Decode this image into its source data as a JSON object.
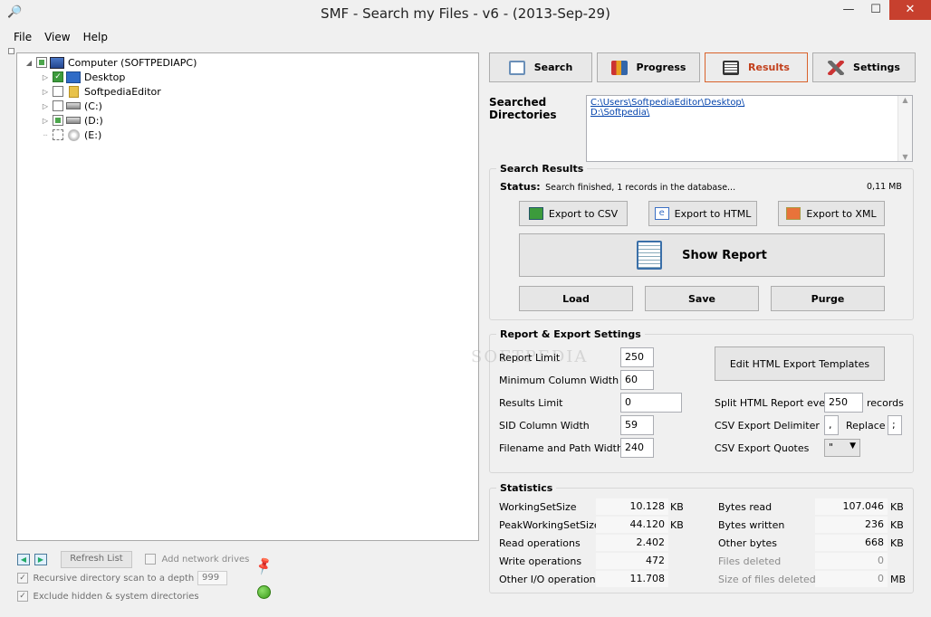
{
  "window": {
    "title": "SMF - Search my Files - v6 - (2013-Sep-29)",
    "minimize": "—",
    "maximize": "☐",
    "close": "✕"
  },
  "menu": [
    "File",
    "View",
    "Help"
  ],
  "tree": {
    "root": "Computer (SOFTPEDIAPC)",
    "items": [
      {
        "label": "Desktop",
        "state": "checked"
      },
      {
        "label": "SoftpediaEditor",
        "state": "empty"
      },
      {
        "label": "(C:)",
        "state": "empty"
      },
      {
        "label": "(D:)",
        "state": "partial"
      },
      {
        "label": "(E:)",
        "state": "empty"
      }
    ]
  },
  "tabs": [
    {
      "label": "Search"
    },
    {
      "label": "Progress"
    },
    {
      "label": "Results"
    },
    {
      "label": "Settings"
    }
  ],
  "searched": {
    "label_line1": "Searched",
    "label_line2": "Directories",
    "dirs": [
      "C:\\Users\\SoftpediaEditor\\Desktop\\",
      "D:\\Softpedia\\"
    ]
  },
  "results": {
    "title": "Search Results",
    "status_label": "Status:",
    "status_text": "Search finished, 1 records in the database...",
    "size": "0,11 MB",
    "export_csv": "Export to CSV",
    "export_html": "Export to HTML",
    "export_xml": "Export to XML",
    "show_report": "Show Report",
    "load": "Load",
    "save": "Save",
    "purge": "Purge"
  },
  "report": {
    "title": "Report & Export Settings",
    "report_limit_label": "Report Limit",
    "report_limit": "250",
    "min_col_label": "Minimum Column Width",
    "min_col": "60",
    "results_limit_label": "Results Limit",
    "results_limit": "0",
    "sid_col_label": "SID Column Width",
    "sid_col": "59",
    "filename_label": "Filename and Path Width",
    "filename": "240",
    "edit_templates": "Edit HTML Export Templates",
    "split_label": "Split HTML Report every",
    "split": "250",
    "split_unit": "records",
    "csv_delim_label": "CSV Export Delimiter",
    "csv_delim": ",",
    "replace_label": "Replace",
    "replace": ";",
    "csv_quotes_label": "CSV Export Quotes",
    "csv_quotes": "\""
  },
  "stats": {
    "title": "Statistics",
    "left": [
      {
        "label": "WorkingSetSize",
        "value": "10.128",
        "unit": "KB"
      },
      {
        "label": "PeakWorkingSetSize",
        "value": "44.120",
        "unit": "KB"
      },
      {
        "label": "Read operations",
        "value": "2.402",
        "unit": ""
      },
      {
        "label": "Write operations",
        "value": "472",
        "unit": ""
      },
      {
        "label": "Other I/O operations",
        "value": "11.708",
        "unit": ""
      }
    ],
    "right": [
      {
        "label": "Bytes read",
        "value": "107.046",
        "unit": "KB"
      },
      {
        "label": "Bytes written",
        "value": "236",
        "unit": "KB"
      },
      {
        "label": "Other bytes",
        "value": "668",
        "unit": "KB"
      },
      {
        "label": "Files deleted",
        "value": "0",
        "unit": ""
      },
      {
        "label": "Size of files deleted",
        "value": "0",
        "unit": "MB"
      }
    ]
  },
  "bottom": {
    "refresh": "Refresh List",
    "add_network": "Add network drives",
    "recursive": "Recursive directory scan to a depth of",
    "depth": "999",
    "exclude": "Exclude hidden & system directories"
  },
  "watermark": "SOFTPEDIA"
}
